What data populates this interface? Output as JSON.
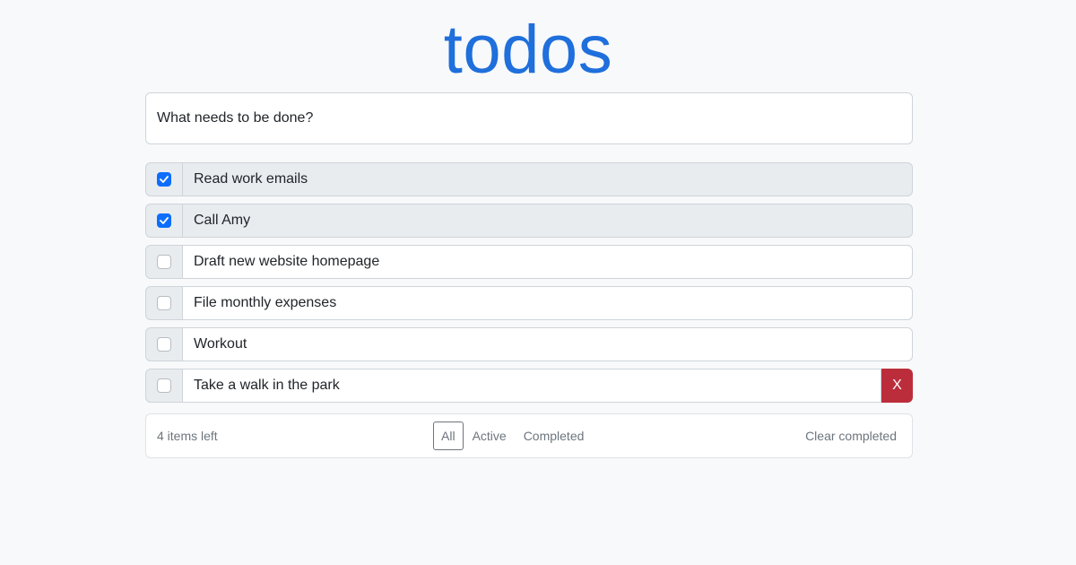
{
  "app": {
    "title": "todos"
  },
  "new_todo": {
    "placeholder": "What needs to be done?"
  },
  "todos": [
    {
      "text": "Read work emails",
      "completed": true
    },
    {
      "text": "Call Amy",
      "completed": true
    },
    {
      "text": "Draft new website homepage",
      "completed": false
    },
    {
      "text": "File monthly expenses",
      "completed": false
    },
    {
      "text": "Workout",
      "completed": false
    },
    {
      "text": "Take a walk in the park",
      "completed": false,
      "delete_label": "X"
    }
  ],
  "footer": {
    "items_left": "4 items left",
    "filters": [
      {
        "label": "All",
        "selected": true
      },
      {
        "label": "Active",
        "selected": false
      },
      {
        "label": "Completed",
        "selected": false
      }
    ],
    "clear_completed": "Clear completed"
  },
  "colors": {
    "title": "#1f6fdc",
    "checked": "#0d6efd",
    "delete": "#bb2d3b",
    "completed_bg": "#e9ecef"
  }
}
